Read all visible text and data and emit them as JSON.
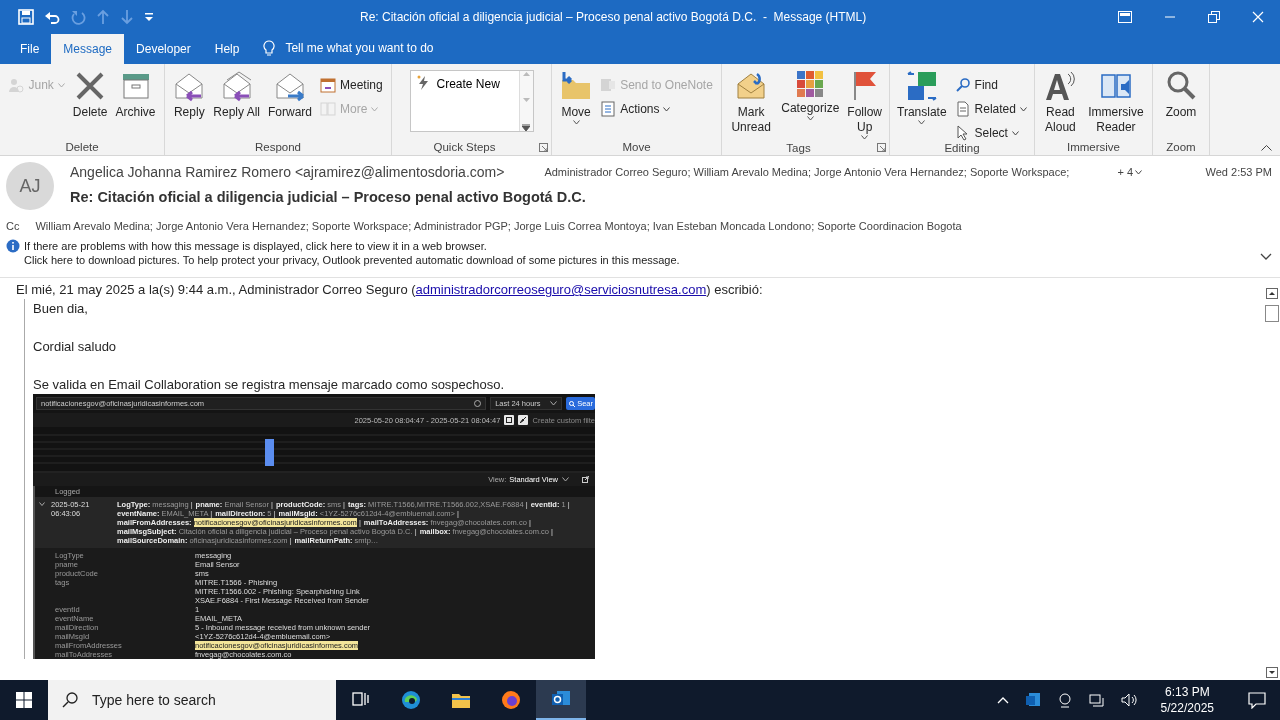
{
  "window": {
    "title": "Re: Citación oficial a diligencia judicial – Proceso penal activo Bogotá D.C.  -  Message (HTML)"
  },
  "tabs": [
    {
      "label": "File",
      "selected": false
    },
    {
      "label": "Message",
      "selected": true
    },
    {
      "label": "Developer",
      "selected": false
    },
    {
      "label": "Help",
      "selected": false
    }
  ],
  "tell_me": {
    "placeholder": "Tell me what you want to do"
  },
  "ribbon": [
    {
      "label": "Delete",
      "launcher": false,
      "items": [
        {
          "kind": "small",
          "label": "Junk",
          "disabled": true,
          "dropdown": true
        },
        {
          "kind": "large",
          "label": "Delete",
          "disabled": false,
          "dropdown": false
        },
        {
          "kind": "large",
          "label": "Archive",
          "disabled": false,
          "dropdown": false
        }
      ]
    },
    {
      "label": "Respond",
      "launcher": false,
      "items": [
        {
          "kind": "large",
          "label": "Reply",
          "disabled": false,
          "dropdown": false
        },
        {
          "kind": "large",
          "label": "Reply All",
          "disabled": false,
          "dropdown": false
        },
        {
          "kind": "large",
          "label": "Forward",
          "disabled": false,
          "dropdown": false
        },
        {
          "kind": "small",
          "label": "Meeting",
          "disabled": false,
          "dropdown": false
        },
        {
          "kind": "small",
          "label": "More",
          "disabled": true,
          "dropdown": true
        }
      ]
    },
    {
      "label": "Quick Steps",
      "launcher": true,
      "items": [
        {
          "kind": "gallery",
          "label": "Create New",
          "disabled": false
        }
      ]
    },
    {
      "label": "Move",
      "launcher": false,
      "items": [
        {
          "kind": "large",
          "label": "Move",
          "disabled": false,
          "dropdown": true
        },
        {
          "kind": "small",
          "label": "Send to OneNote",
          "disabled": true,
          "dropdown": false
        },
        {
          "kind": "small",
          "label": "Actions",
          "disabled": false,
          "dropdown": true
        }
      ]
    },
    {
      "label": "Tags",
      "launcher": true,
      "items": [
        {
          "kind": "large",
          "label": "Mark Unread",
          "disabled": false,
          "dropdown": false
        },
        {
          "kind": "large",
          "label": "Categorize",
          "disabled": false,
          "dropdown": true
        },
        {
          "kind": "large",
          "label": "Follow Up",
          "disabled": false,
          "dropdown": true
        }
      ]
    },
    {
      "label": "Editing",
      "launcher": false,
      "items": [
        {
          "kind": "large",
          "label": "Translate",
          "disabled": false,
          "dropdown": true
        },
        {
          "kind": "small",
          "label": "Find",
          "disabled": false,
          "dropdown": false
        },
        {
          "kind": "small",
          "label": "Related",
          "disabled": false,
          "dropdown": true
        },
        {
          "kind": "small",
          "label": "Select",
          "disabled": false,
          "dropdown": true
        }
      ]
    },
    {
      "label": "Immersive",
      "launcher": false,
      "items": [
        {
          "kind": "large",
          "label": "Read Aloud",
          "disabled": false,
          "dropdown": false
        },
        {
          "kind": "large",
          "label": "Immersive Reader",
          "disabled": false,
          "dropdown": false
        }
      ]
    },
    {
      "label": "Zoom",
      "launcher": false,
      "items": [
        {
          "kind": "large",
          "label": "Zoom",
          "disabled": false,
          "dropdown": false
        }
      ]
    }
  ],
  "message": {
    "avatar": "AJ",
    "from": "Angelica Johanna Ramirez Romero <ajramirez@alimentosdoria.com>",
    "subject": "Re: Citación oficial a diligencia judicial – Proceso penal activo Bogotá D.C.",
    "to": "Administrador Correo Seguro; William Arevalo Medina; Jorge Antonio Vera Hernandez; Soporte Workspace;",
    "more_recipients": "+ 4",
    "date": "Wed 2:53 PM",
    "cc_label": "Cc",
    "cc": "William Arevalo Medina; Jorge Antonio Vera Hernandez; Soporte Workspace; Administrador PGP; Jorge Luis Correa Montoya; Ivan Esteban Moncada Londono; Soporte Coordinacion Bogota",
    "info": [
      "If there are problems with how this message is displayed, click here to view it in a web browser.",
      "Click here to download pictures. To help protect your privacy, Outlook prevented automatic download of some pictures in this message."
    ]
  },
  "body": {
    "quote_header": {
      "before": "El mié, 21 may 2025 a la(s) 9:44 a.m., Administrador Correo Seguro (",
      "link": "administradorcorreoseguro@serviciosnutresa.com",
      "after": ") escribió:"
    },
    "paragraphs": [
      "Buen dia,",
      "Cordial saludo",
      "Se valida en Email Collaboration se registra mensaje marcado como sospechoso."
    ],
    "screenshot": {
      "search_value": "notificacionesgov@oficinasjuridicasinformes.com",
      "range": "Last 24 hours",
      "search_button": "Sear",
      "date_range": "2025-05-20 08:04:47 - 2025-05-21 08:04:47",
      "filter_button": "Create custom filte",
      "view_label": "View:",
      "view": "Standard View",
      "column": "Logged",
      "event": {
        "expanded": true,
        "time": "2025-05-21 06:43:06",
        "separator": "|",
        "summary": [
          {
            "key": "LogType:",
            "value": "messaging",
            "highlighted": false
          },
          {
            "key": "pname:",
            "value": "Email Sensor",
            "highlighted": false
          },
          {
            "key": "productCode:",
            "value": "sms",
            "highlighted": false
          },
          {
            "key": "tags:",
            "value": "MITRE.T1566,MITRE.T1566.002,XSAE.F6884",
            "highlighted": false
          },
          {
            "key": "eventId:",
            "value": "1",
            "highlighted": false
          },
          {
            "key": "eventName:",
            "value": "EMAIL_META",
            "highlighted": false
          },
          {
            "key": "mailDirection:",
            "value": "5",
            "highlighted": false
          },
          {
            "key": "mailMsgId:",
            "value": "<1YZ-5276c612d4-4@embluemail.com>",
            "highlighted": false
          },
          {
            "key": "mailFromAddresses:",
            "value": "notificacionesgov@oficinasjuridicasinformes.com",
            "highlighted": true
          },
          {
            "key": "mailToAddresses:",
            "value": "fnvegag@chocolates.com.co",
            "highlighted": false
          },
          {
            "key": "mailMsgSubject:",
            "value": "Citación oficial a diligencia judicial – Proceso penal activo Bogotá D.C.",
            "highlighted": false
          },
          {
            "key": "mailbox:",
            "value": "fnvegag@chocolates.com.co",
            "highlighted": false
          },
          {
            "key": "mailSourceDomain:",
            "value": "oficinasjuridicasinformes.com",
            "highlighted": false
          },
          {
            "key": "mailReturnPath:",
            "value": "smtp…",
            "highlighted": false
          }
        ],
        "details": [
          {
            "key": "LogType",
            "lines": [
              "messaging"
            ],
            "highlighted": false
          },
          {
            "key": "pname",
            "lines": [
              "Email Sensor"
            ],
            "highlighted": false
          },
          {
            "key": "productCode",
            "lines": [
              "sms"
            ],
            "highlighted": false
          },
          {
            "key": "tags",
            "lines": [
              "MITRE.T1566 - Phishing",
              "MITRE.T1566.002 - Phishing: Spearphishing Link",
              "XSAE.F6884 - First Message Received from Sender"
            ],
            "highlighted": false
          },
          {
            "key": "eventId",
            "lines": [
              "1"
            ],
            "highlighted": false
          },
          {
            "key": "eventName",
            "lines": [
              "EMAIL_META"
            ],
            "highlighted": false
          },
          {
            "key": "mailDirection",
            "lines": [
              "5 - Inbound message received from unknown sender"
            ],
            "highlighted": false
          },
          {
            "key": "mailMsgId",
            "lines": [
              "<1YZ-5276c612d4-4@embluemail.com>"
            ],
            "highlighted": false
          },
          {
            "key": "mailFromAddresses",
            "lines": [
              "notificacionesgov@oficinasjuridicasinformes.com"
            ],
            "highlighted": true
          },
          {
            "key": "mailToAddresses",
            "lines": [
              "fnvegag@chocolates.com.co"
            ],
            "highlighted": false
          }
        ]
      }
    }
  },
  "taskbar": {
    "search_placeholder": "Type here to search",
    "apps": [
      {
        "selected": false
      },
      {
        "selected": false
      },
      {
        "selected": false
      },
      {
        "selected": false
      },
      {
        "selected": true
      }
    ],
    "time": "6:13 PM",
    "date": "5/22/2025"
  }
}
